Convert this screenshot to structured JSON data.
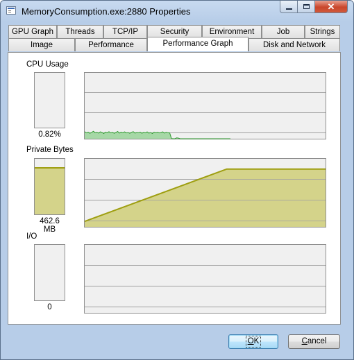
{
  "window": {
    "title": "MemoryConsumption.exe:2880 Properties",
    "close_glyph": "✕"
  },
  "tabs": {
    "row_back": [
      "GPU Graph",
      "Threads",
      "TCP/IP",
      "Security",
      "Environment",
      "Job",
      "Strings"
    ],
    "row_front": [
      "Image",
      "Performance",
      "Performance Graph",
      "Disk and Network"
    ],
    "active": "Performance Graph"
  },
  "sections": {
    "cpu": {
      "label": "CPU Usage",
      "value": "0.82%",
      "fill_fraction": 0.0
    },
    "private_bytes": {
      "label": "Private Bytes",
      "value": "462.6 MB",
      "fill_fraction": 0.85
    },
    "io": {
      "label": "I/O",
      "value": "0",
      "fill_fraction": 0.0
    }
  },
  "graph_series": {
    "cpu": [
      3.4,
      2.8,
      3.2,
      2.6,
      3.0,
      3.6,
      2.9,
      3.1,
      2.7,
      3.3,
      3.0,
      2.5,
      3.2,
      2.9,
      3.4,
      2.8,
      3.1,
      2.6,
      3.0,
      3.5,
      2.7,
      3.2,
      2.9,
      3.3,
      2.8,
      3.0,
      2.6,
      3.1,
      3.4,
      2.7,
      3.0,
      2.9,
      3.2,
      2.6,
      3.1,
      2.8,
      3.3,
      2.7,
      3.0,
      2.5,
      3.2,
      2.9,
      3.1,
      2.8,
      3.0,
      3.3,
      2.7,
      3.1,
      2.9,
      2.8,
      0.1,
      0.0,
      0.0,
      0.4,
      0.3,
      0.0,
      0.0,
      0.0,
      0.0,
      0.0,
      0.0,
      0.0,
      0.0,
      0.0,
      0.0,
      0.0,
      0.0,
      0.0,
      0.0,
      0.0,
      0.0,
      0.0,
      0.0,
      0.0,
      0.0,
      0.0,
      0.0,
      0.0,
      0.0,
      0.0,
      0.0,
      0.0,
      0.0,
      0.0,
      0.0
    ],
    "cpu_color": "#2e9a2e",
    "cpu_fill": "#a6d8a6",
    "private_bytes": [
      {
        "t": 0.0,
        "v": 0.08
      },
      {
        "t": 0.59,
        "v": 0.85
      },
      {
        "t": 1.0,
        "v": 0.85
      }
    ],
    "private_color": "#9e9e10",
    "private_fill": "#d4d38a",
    "grid_color": "#a0a0a0",
    "graph_bg": "#f0f0f0"
  },
  "buttons": {
    "ok": {
      "label": "OK",
      "accel": "O"
    },
    "cancel": {
      "label": "Cancel",
      "accel": "C"
    }
  },
  "icons": {
    "app": "window-icon",
    "minimize": "minimize-icon",
    "maximize": "maximize-icon",
    "close": "close-icon"
  }
}
